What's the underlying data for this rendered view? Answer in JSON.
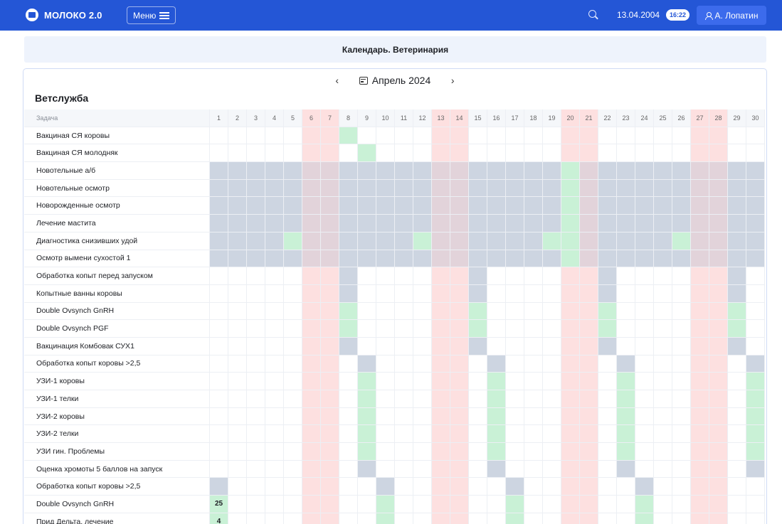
{
  "app": {
    "logo_text": "МОЛОКО 2.0",
    "menu_label": "Меню"
  },
  "topbar": {
    "date": "13.04.2004",
    "time": "16:22",
    "user": "А. Лопатин"
  },
  "page": {
    "title": "Календарь. Ветеринария"
  },
  "calendar": {
    "month_label": "Апрель 2024",
    "section_title": "Ветслужба",
    "task_header": "Задача",
    "days": [
      1,
      2,
      3,
      4,
      5,
      6,
      7,
      8,
      9,
      10,
      11,
      12,
      13,
      14,
      15,
      16,
      17,
      18,
      19,
      20,
      21,
      22,
      23,
      24,
      25,
      26,
      27,
      28,
      29,
      30
    ],
    "weekends": [
      6,
      7,
      13,
      14,
      20,
      21,
      27,
      28
    ],
    "colors": {
      "weekend": "#fde0e0",
      "planned": "#cdd5e1",
      "active": "#c9f1d6",
      "accent": "#2456d6"
    },
    "tasks": [
      {
        "name": "Вакциная СЯ коровы",
        "planned": [],
        "active": [
          8
        ],
        "counts": {}
      },
      {
        "name": "Вакциная СЯ молодняк",
        "planned": [],
        "active": [
          9
        ],
        "counts": {}
      },
      {
        "name": "Новотельные а/б",
        "planned": [
          1,
          2,
          3,
          4,
          5,
          6,
          7,
          8,
          9,
          10,
          11,
          12,
          13,
          14,
          15,
          16,
          17,
          18,
          19,
          21,
          22,
          23,
          24,
          25,
          26,
          27,
          28,
          29,
          30
        ],
        "active": [
          20
        ],
        "counts": {}
      },
      {
        "name": "Новотельные осмотр",
        "planned": [
          1,
          2,
          3,
          4,
          5,
          6,
          7,
          8,
          9,
          10,
          11,
          12,
          13,
          14,
          15,
          16,
          17,
          18,
          19,
          21,
          22,
          23,
          24,
          25,
          26,
          27,
          28,
          29,
          30
        ],
        "active": [
          20
        ],
        "counts": {}
      },
      {
        "name": "Новорожденные осмотр",
        "planned": [
          1,
          2,
          3,
          4,
          5,
          6,
          7,
          8,
          9,
          10,
          11,
          12,
          13,
          14,
          15,
          16,
          17,
          18,
          19,
          21,
          22,
          23,
          24,
          25,
          26,
          27,
          28,
          29,
          30
        ],
        "active": [
          20
        ],
        "counts": {}
      },
      {
        "name": "Лечение мастита",
        "planned": [
          1,
          2,
          3,
          4,
          5,
          6,
          7,
          8,
          9,
          10,
          11,
          12,
          13,
          14,
          15,
          16,
          17,
          18,
          19,
          21,
          22,
          23,
          24,
          25,
          26,
          27,
          28,
          29,
          30
        ],
        "active": [
          20
        ],
        "counts": {}
      },
      {
        "name": "Диагностика снизивших удой",
        "planned": [
          1,
          2,
          3,
          4,
          6,
          7,
          8,
          9,
          10,
          11,
          13,
          14,
          15,
          16,
          17,
          18,
          21,
          22,
          23,
          24,
          25,
          27,
          28,
          29,
          30
        ],
        "active": [
          5,
          12,
          19,
          20,
          26
        ],
        "counts": {}
      },
      {
        "name": "Осмотр вымени сухостой 1",
        "planned": [
          1,
          2,
          3,
          4,
          5,
          6,
          7,
          8,
          9,
          10,
          11,
          12,
          13,
          14,
          15,
          16,
          17,
          18,
          19,
          21,
          22,
          23,
          24,
          25,
          26,
          27,
          28,
          29,
          30
        ],
        "active": [
          20
        ],
        "counts": {}
      },
      {
        "name": "Обработка копыт перед запуском",
        "planned": [
          8,
          15,
          22,
          29
        ],
        "active": [],
        "counts": {}
      },
      {
        "name": "Копытные ванны коровы",
        "planned": [
          8,
          15,
          22,
          29
        ],
        "active": [],
        "counts": {}
      },
      {
        "name": "Double Ovsynch GnRH",
        "planned": [],
        "active": [
          8,
          15,
          22,
          29
        ],
        "counts": {}
      },
      {
        "name": "Double Ovsynch PGF",
        "planned": [],
        "active": [
          8,
          15,
          22,
          29
        ],
        "counts": {}
      },
      {
        "name": "Вакцинация Комбовак СУХ1",
        "planned": [
          8,
          15,
          22,
          29
        ],
        "active": [],
        "counts": {}
      },
      {
        "name": "Обработка копыт коровы >2,5",
        "planned": [
          9,
          16,
          23,
          30
        ],
        "active": [],
        "counts": {}
      },
      {
        "name": "УЗИ-1 коровы",
        "planned": [],
        "active": [
          9,
          16,
          23,
          30
        ],
        "counts": {}
      },
      {
        "name": "УЗИ-1 телки",
        "planned": [],
        "active": [
          9,
          16,
          23,
          30
        ],
        "counts": {}
      },
      {
        "name": "УЗИ-2 коровы",
        "planned": [],
        "active": [
          9,
          16,
          23,
          30
        ],
        "counts": {}
      },
      {
        "name": "УЗИ-2 телки",
        "planned": [],
        "active": [
          9,
          16,
          23,
          30
        ],
        "counts": {}
      },
      {
        "name": "УЗИ гин. Проблемы",
        "planned": [],
        "active": [
          9,
          16,
          23,
          30
        ],
        "counts": {}
      },
      {
        "name": "Оценка хромоты 5 баллов на запуск",
        "planned": [
          9,
          16,
          23,
          30
        ],
        "active": [],
        "counts": {}
      },
      {
        "name": "Обработка копыт коровы >2,5",
        "planned": [
          1,
          10,
          17,
          24
        ],
        "active": [],
        "counts": {}
      },
      {
        "name": "Double Ovsynch GnRH",
        "planned": [],
        "active": [
          1,
          10,
          17,
          24
        ],
        "counts": {
          "1": "25"
        }
      },
      {
        "name": "Прид Дельта, лечение",
        "planned": [],
        "active": [
          1,
          10,
          17,
          24
        ],
        "counts": {
          "1": "4"
        }
      }
    ]
  }
}
